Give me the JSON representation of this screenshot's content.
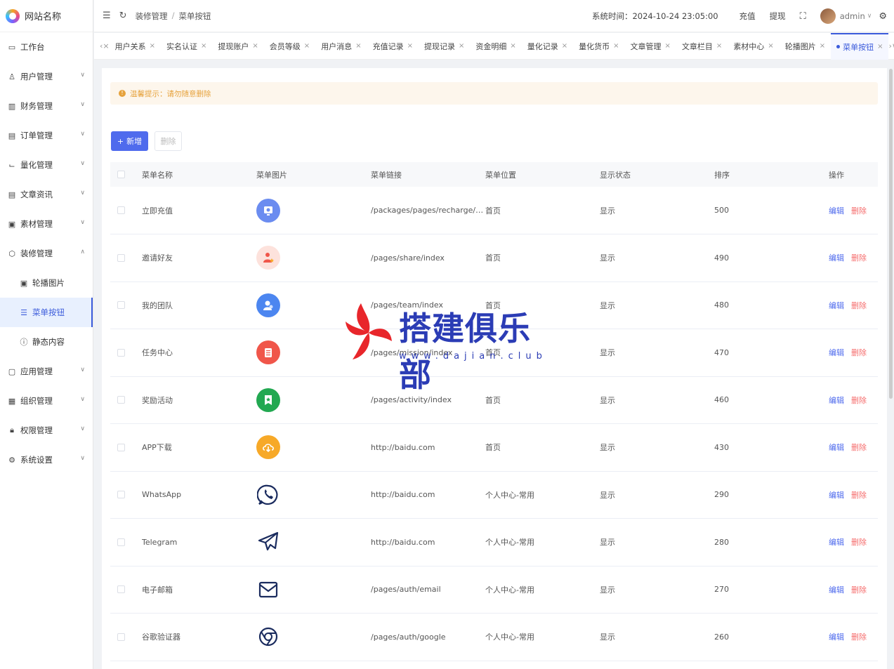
{
  "app": {
    "site_name": "网站名称"
  },
  "sidebar": {
    "items": [
      {
        "label": "工作台",
        "icon": "monitor-icon",
        "glyph": "▭",
        "arrow": false,
        "sub": false,
        "active": false
      },
      {
        "label": "用户管理",
        "icon": "user-icon",
        "glyph": "♙",
        "arrow": true,
        "arrow_dir": "down",
        "sub": false,
        "active": false
      },
      {
        "label": "财务管理",
        "icon": "chart-icon",
        "glyph": "▥",
        "arrow": true,
        "arrow_dir": "down",
        "sub": false,
        "active": false
      },
      {
        "label": "订单管理",
        "icon": "order-icon",
        "glyph": "▤",
        "arrow": true,
        "arrow_dir": "down",
        "sub": false,
        "active": false
      },
      {
        "label": "量化管理",
        "icon": "quant-icon",
        "glyph": "⌙",
        "arrow": true,
        "arrow_dir": "down",
        "sub": false,
        "active": false
      },
      {
        "label": "文章资讯",
        "icon": "article-icon",
        "glyph": "▤",
        "arrow": true,
        "arrow_dir": "down",
        "sub": false,
        "active": false
      },
      {
        "label": "素材管理",
        "icon": "material-icon",
        "glyph": "▣",
        "arrow": true,
        "arrow_dir": "down",
        "sub": false,
        "active": false
      },
      {
        "label": "装修管理",
        "icon": "decorate-icon",
        "glyph": "⬡",
        "arrow": true,
        "arrow_dir": "up",
        "sub": false,
        "active": false
      },
      {
        "label": "轮播图片",
        "icon": "image-icon",
        "glyph": "▣",
        "arrow": false,
        "sub": true,
        "active": false
      },
      {
        "label": "菜单按钮",
        "icon": "list-icon",
        "glyph": "☰",
        "arrow": false,
        "sub": true,
        "active": true
      },
      {
        "label": "静态内容",
        "icon": "info-icon",
        "glyph": "ⓘ",
        "arrow": false,
        "sub": true,
        "active": false
      },
      {
        "label": "应用管理",
        "icon": "app-icon",
        "glyph": "▢",
        "arrow": true,
        "arrow_dir": "down",
        "sub": false,
        "active": false
      },
      {
        "label": "组织管理",
        "icon": "org-icon",
        "glyph": "▦",
        "arrow": true,
        "arrow_dir": "down",
        "sub": false,
        "active": false
      },
      {
        "label": "权限管理",
        "icon": "lock-icon",
        "glyph": "🔒︎",
        "arrow": true,
        "arrow_dir": "down",
        "sub": false,
        "active": false
      },
      {
        "label": "系统设置",
        "icon": "gear-icon",
        "glyph": "⚙",
        "arrow": true,
        "arrow_dir": "down",
        "sub": false,
        "active": false
      }
    ]
  },
  "header": {
    "breadcrumb": [
      "装修管理",
      "菜单按钮"
    ],
    "system_time": "系统时间：2024-10-24 23:05:00",
    "recharge": "充值",
    "withdraw": "提现",
    "user": "admin"
  },
  "tabs": [
    {
      "label": "用户关系",
      "active": false
    },
    {
      "label": "实名认证",
      "active": false
    },
    {
      "label": "提现账户",
      "active": false
    },
    {
      "label": "会员等级",
      "active": false
    },
    {
      "label": "用户消息",
      "active": false
    },
    {
      "label": "充值记录",
      "active": false
    },
    {
      "label": "提现记录",
      "active": false
    },
    {
      "label": "资金明细",
      "active": false
    },
    {
      "label": "量化记录",
      "active": false
    },
    {
      "label": "量化货币",
      "active": false
    },
    {
      "label": "文章管理",
      "active": false
    },
    {
      "label": "文章栏目",
      "active": false
    },
    {
      "label": "素材中心",
      "active": false
    },
    {
      "label": "轮播图片",
      "active": false
    },
    {
      "label": "菜单按钮",
      "active": true
    }
  ],
  "notice": "温馨提示：请勿随意删除",
  "toolbar": {
    "add_label": "新增",
    "delete_label": "删除"
  },
  "table": {
    "headers": [
      "菜单名称",
      "菜单图片",
      "菜单链接",
      "菜单位置",
      "显示状态",
      "排序",
      "操作"
    ],
    "edit_label": "编辑",
    "delete_label": "删除",
    "rows": [
      {
        "name": "立即充值",
        "icon": "recharge-icon",
        "link": "/packages/pages/recharge/in...",
        "position": "首页",
        "status": "显示",
        "sort": "500",
        "bg": "#6b8cf0",
        "style": "circle"
      },
      {
        "name": "邀请好友",
        "icon": "invite-icon",
        "link": "/pages/share/index",
        "position": "首页",
        "status": "显示",
        "sort": "490",
        "bg": "#fde2dc",
        "style": "circle"
      },
      {
        "name": "我的团队",
        "icon": "team-icon",
        "link": "/pages/team/index",
        "position": "首页",
        "status": "显示",
        "sort": "480",
        "bg": "#4c86f0",
        "style": "circle"
      },
      {
        "name": "任务中心",
        "icon": "task-icon",
        "link": "/pages/mission/index",
        "position": "首页",
        "status": "显示",
        "sort": "470",
        "bg": "#f0564a",
        "style": "circle"
      },
      {
        "name": "奖励活动",
        "icon": "reward-icon",
        "link": "/pages/activity/index",
        "position": "首页",
        "status": "显示",
        "sort": "460",
        "bg": "#22a851",
        "style": "circle"
      },
      {
        "name": "APP下载",
        "icon": "download-icon",
        "link": "http://baidu.com",
        "position": "首页",
        "status": "显示",
        "sort": "430",
        "bg": "#f7a928",
        "style": "circle"
      },
      {
        "name": "WhatsApp",
        "icon": "whatsapp-icon",
        "link": "http://baidu.com",
        "position": "个人中心-常用",
        "status": "显示",
        "sort": "290",
        "bg": "#ffffff",
        "style": "plain"
      },
      {
        "name": "Telegram",
        "icon": "telegram-icon",
        "link": "http://baidu.com",
        "position": "个人中心-常用",
        "status": "显示",
        "sort": "280",
        "bg": "#ffffff",
        "style": "plain"
      },
      {
        "name": "电子邮箱",
        "icon": "email-icon",
        "link": "/pages/auth/email",
        "position": "个人中心-常用",
        "status": "显示",
        "sort": "270",
        "bg": "#ffffff",
        "style": "plain"
      },
      {
        "name": "谷歌验证器",
        "icon": "google-icon",
        "link": "/pages/auth/google",
        "position": "个人中心-常用",
        "status": "显示",
        "sort": "260",
        "bg": "#ffffff",
        "style": "plain"
      }
    ]
  },
  "watermark": {
    "title": "搭建俱乐部",
    "url": "www.dajian.club"
  }
}
